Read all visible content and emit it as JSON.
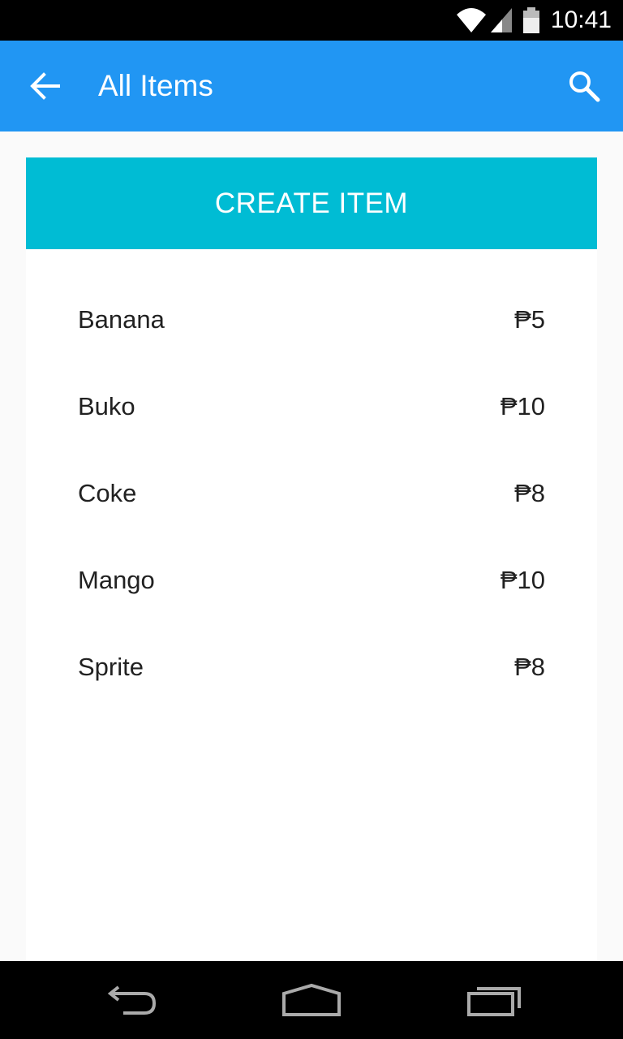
{
  "status_bar": {
    "time": "10:41",
    "icons": [
      "wifi-icon",
      "signal-icon",
      "battery-icon"
    ]
  },
  "app_bar": {
    "title": "All Items",
    "back_icon": "arrow-back-icon",
    "search_icon": "search-icon",
    "color": "#2196f3"
  },
  "create_button": {
    "label": "CREATE ITEM",
    "color": "#00bcd4"
  },
  "items": [
    {
      "name": "Banana",
      "price": "₱5"
    },
    {
      "name": "Buko",
      "price": "₱10"
    },
    {
      "name": "Coke",
      "price": "₱8"
    },
    {
      "name": "Mango",
      "price": "₱10"
    },
    {
      "name": "Sprite",
      "price": "₱8"
    }
  ],
  "nav_bar": {
    "icons": [
      "back-nav-icon",
      "home-nav-icon",
      "recents-nav-icon"
    ]
  }
}
